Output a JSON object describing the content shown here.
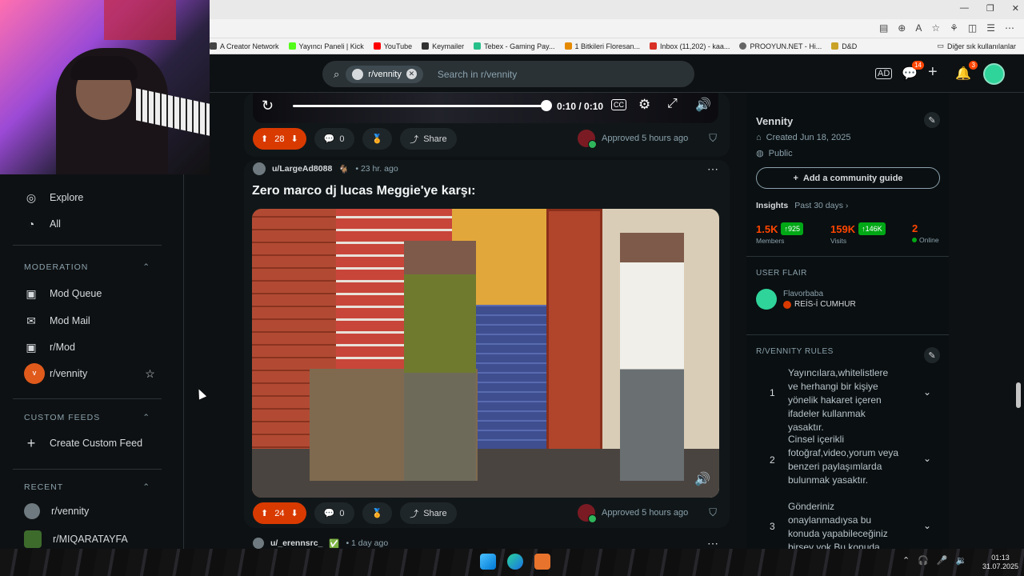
{
  "browser": {
    "window_controls": [
      "—",
      "❐",
      "✕"
    ],
    "bookmarks": [
      {
        "label": "A Creator Network",
        "color": "#444"
      },
      {
        "label": "Yayıncı Paneli | Kick",
        "color": "#53fc18"
      },
      {
        "label": "YouTube",
        "color": "#ff0000"
      },
      {
        "label": "Keymailer",
        "color": "#333"
      },
      {
        "label": "Tebex - Gaming Pay...",
        "color": "#27c08a"
      },
      {
        "label": "1 Bitkileri Floresan...",
        "color": "#e58a00"
      },
      {
        "label": "Inbox (11,202) - kaa...",
        "color": "#d93025"
      },
      {
        "label": "PROOYUN.NET - Hi...",
        "color": "#666"
      },
      {
        "label": "D&D",
        "color": "#c9a227"
      }
    ],
    "other_bookmarks": "Diğer sık kullanılanlar"
  },
  "header": {
    "search_chip": "r/vennity",
    "search_placeholder": "Search in r/vennity",
    "chat_badge": "14",
    "notif_badge": "3"
  },
  "webcam": {
    "label": "streamer webcam overlay"
  },
  "leftnav": {
    "explore": "Explore",
    "all": "All",
    "moderation_title": "MODERATION",
    "mod_queue": "Mod Queue",
    "mod_mail": "Mod Mail",
    "r_mod": "r/Mod",
    "r_vennity": "r/vennity",
    "custom_feeds_title": "CUSTOM FEEDS",
    "create_custom_feed": "Create Custom Feed",
    "recent_title": "RECENT",
    "recent": [
      "r/vennity",
      "r/MIQARATAYFA"
    ]
  },
  "player": {
    "time": "0:10 / 0:10",
    "progress": 1.0,
    "cc": "CC"
  },
  "posts": [
    {
      "upvotes": "28",
      "comments": "0",
      "share": "Share",
      "approved": "Approved 5 hours ago"
    },
    {
      "author": "u/LargeAd8088",
      "age": "• 23 hr. ago",
      "title": "Zero marco dj lucas Meggie'ye karşı:",
      "upvotes": "24",
      "comments": "0",
      "share": "Share",
      "approved": "Approved 5 hours ago"
    },
    {
      "author": "u/_erennsrc_",
      "age": "• 1 day ago"
    }
  ],
  "sidebar": {
    "name": "Vennity",
    "created": "Created Jun 18, 2025",
    "visibility": "Public",
    "guide_button": "Add a community guide",
    "insights_label": "Insights",
    "insights_period": "Past 30 days ›",
    "members_value": "1.5K",
    "members_change": "↑925",
    "members_label": "Members",
    "visits_value": "159K",
    "visits_change": "↑146K",
    "visits_label": "Visits",
    "online_value": "2",
    "online_label": "Online",
    "flair_title": "USER FLAIR",
    "flair_user": "Flavorbaba",
    "flair_tag": "REİS-İ CUMHUR",
    "rules_title": "R/VENNITY RULES",
    "rules": [
      {
        "num": "1",
        "text": "Yayıncılara,whitelistlere ve herhangi bir kişiye yönelik hakaret içeren ifadeler kullanmak yasaktır."
      },
      {
        "num": "2",
        "text": "Cinsel içerikli fotoğraf,video,yorum veya benzeri paylaşımlarda bulunmak yasaktır."
      },
      {
        "num": "3",
        "text": "Gönderiniz onaylanmadıysa bu konuda yapabileceğiniz birşey yok.Bu konuda modları darlamak yasaktır."
      }
    ]
  },
  "taskbar": {
    "time": "01:13",
    "date": "31.07.2025"
  }
}
